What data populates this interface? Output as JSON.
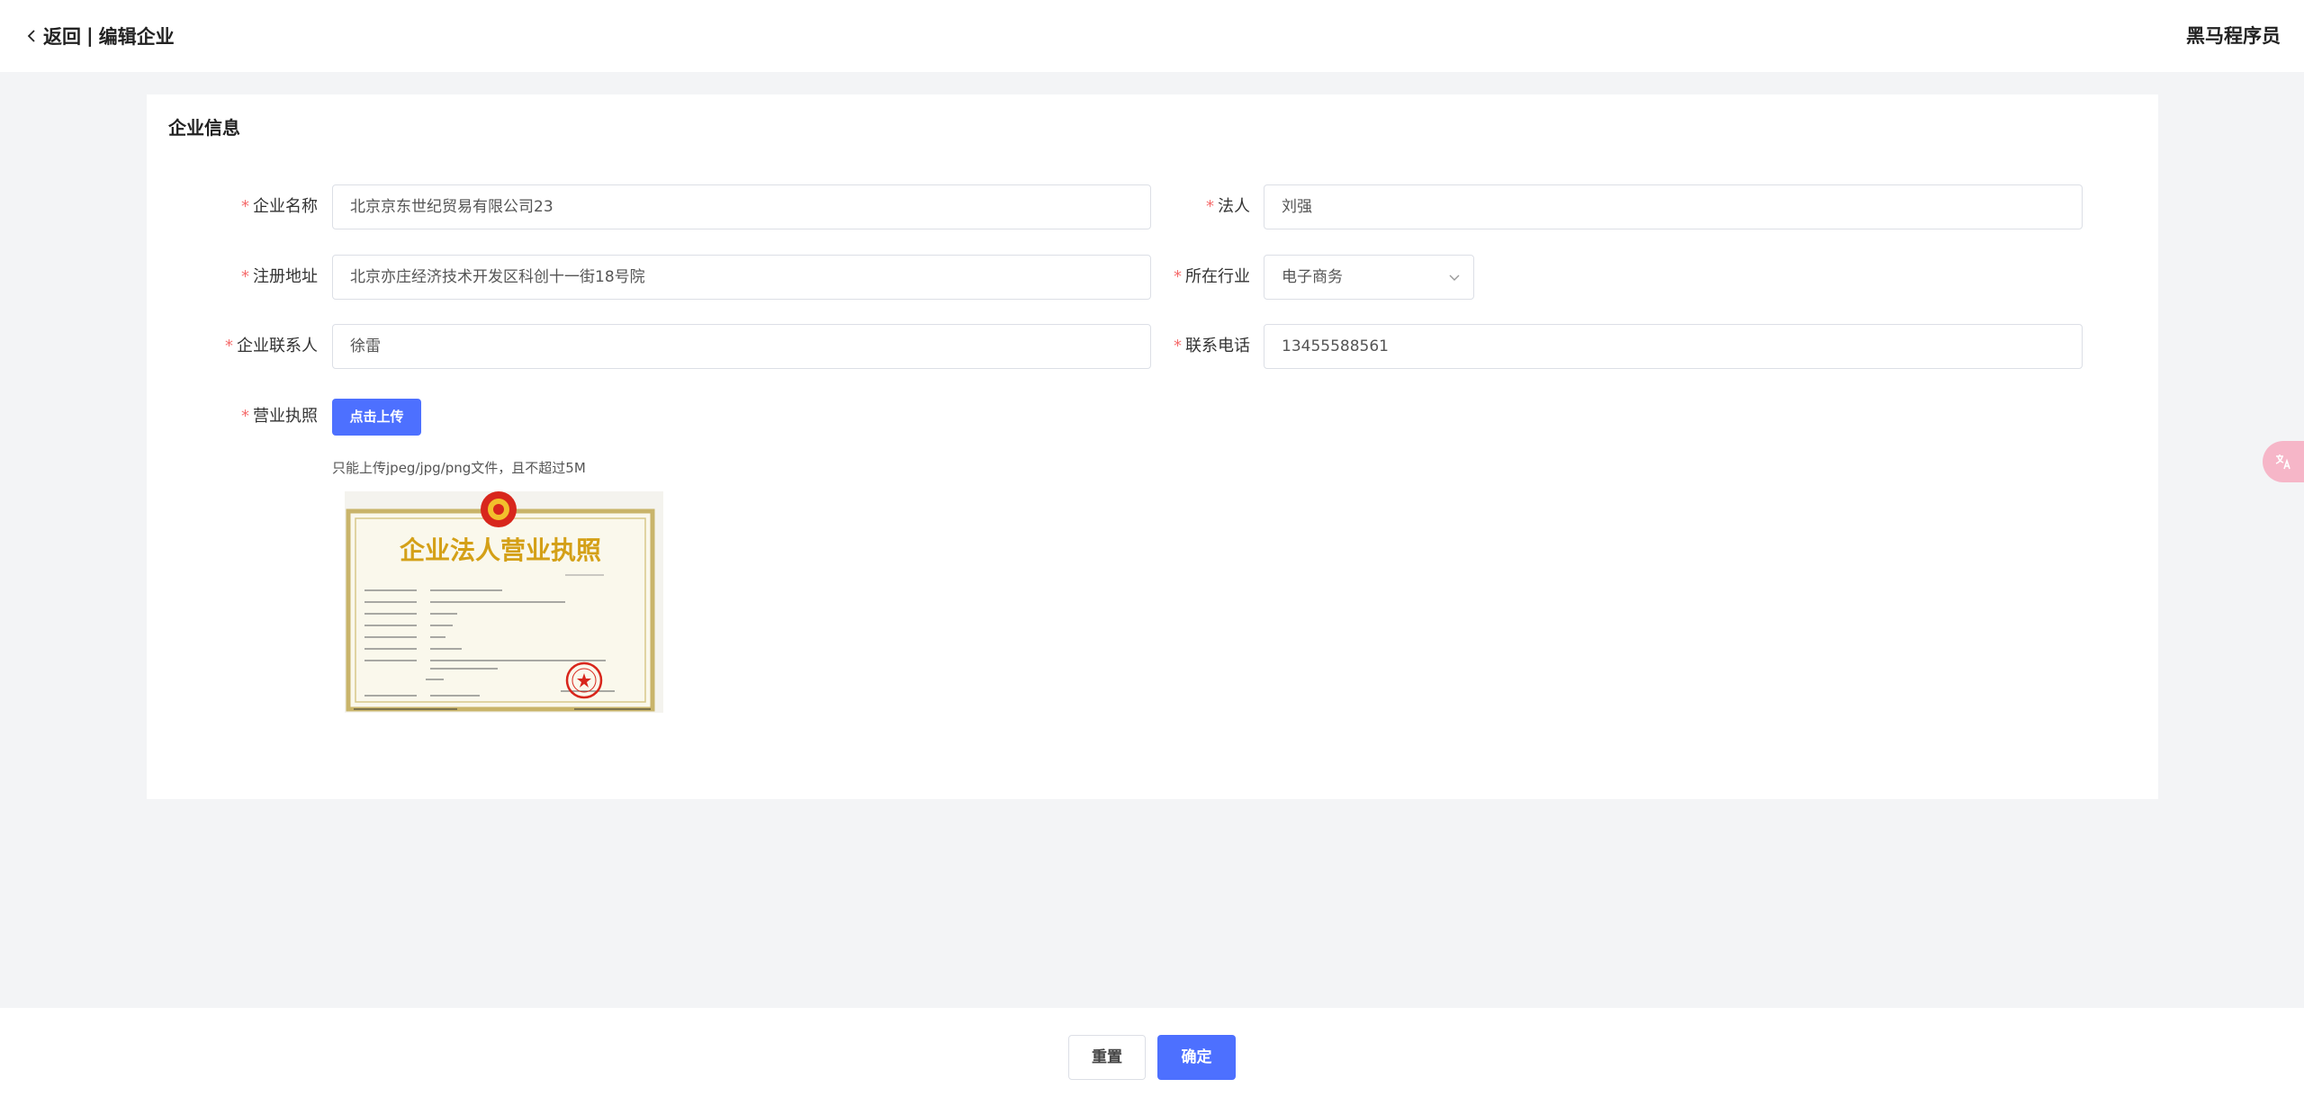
{
  "header": {
    "back_label": "返回",
    "separator": "|",
    "page_title": "编辑企业",
    "user_name": "黑马程序员"
  },
  "form": {
    "section_title": "企业信息",
    "required_mark": "*",
    "fields": {
      "company_name": {
        "label": "企业名称",
        "value": "北京京东世纪贸易有限公司23"
      },
      "legal_person": {
        "label": "法人",
        "value": "刘强"
      },
      "reg_address": {
        "label": "注册地址",
        "value": "北京亦庄经济技术开发区科创十一街18号院"
      },
      "industry": {
        "label": "所在行业",
        "value": "电子商务"
      },
      "contact": {
        "label": "企业联系人",
        "value": "徐雷"
      },
      "phone": {
        "label": "联系电话",
        "value": "13455588561"
      },
      "license": {
        "label": "营业执照",
        "upload_label": "点击上传",
        "tip": "只能上传jpeg/jpg/png文件，且不超过5M"
      }
    }
  },
  "license_image": {
    "title": "企业法人营业执照"
  },
  "footer": {
    "reset_label": "重置",
    "confirm_label": "确定"
  },
  "colors": {
    "primary": "#4d70ff",
    "required": "#f56c6c",
    "page_bg": "#f3f4f6"
  }
}
